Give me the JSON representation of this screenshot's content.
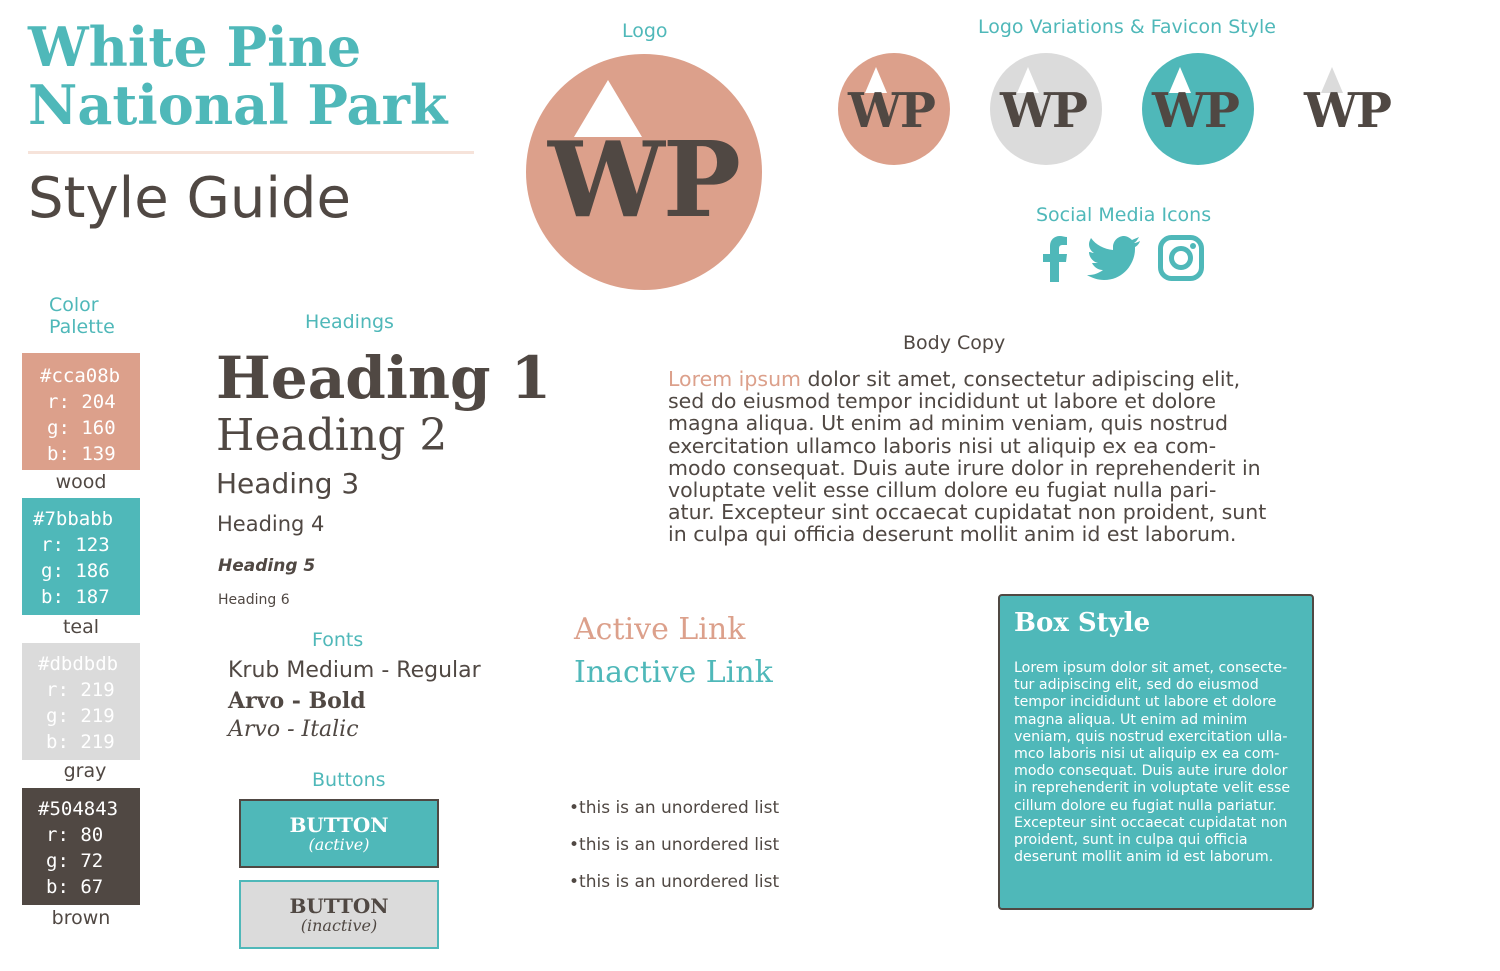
{
  "header": {
    "title_line1": "White Pine",
    "title_line2": "National Park",
    "subtitle": "Style Guide"
  },
  "logo": {
    "label": "Logo",
    "text": "WP"
  },
  "logo_variations": {
    "label": "Logo Variations & Favicon Style",
    "items": [
      {
        "text": "WP",
        "background": "#dca08b",
        "peak": "#ffffff"
      },
      {
        "text": "WP",
        "background": "#dbdbdb",
        "peak": "#ffffff"
      },
      {
        "text": "WP",
        "background": "#4fb8b9",
        "peak": "#ffffff"
      },
      {
        "text": "WP",
        "background": "none",
        "peak": "#dbdbdb"
      }
    ]
  },
  "social": {
    "label": "Social Media Icons",
    "icons": [
      "facebook-icon",
      "twitter-icon",
      "instagram-icon"
    ]
  },
  "palette": {
    "label_line1": "Color",
    "label_line2": "Palette",
    "swatches": [
      {
        "hex": "#cca08b",
        "r": "r: 204",
        "g": "g: 160",
        "b": "b: 139",
        "name": "wood",
        "color": "#dca08b"
      },
      {
        "hex": "#7bbabb",
        "r": "r: 123",
        "g": "g: 186",
        "b": "b: 187",
        "name": "teal",
        "color": "#4fb8b9"
      },
      {
        "hex": "#dbdbdb",
        "r": "r: 219",
        "g": "g: 219",
        "b": "b: 219",
        "name": "gray",
        "color": "#dbdbdb"
      },
      {
        "hex": "#504843",
        "r": "r: 80",
        "g": "g: 72",
        "b": "b: 67",
        "name": "brown",
        "color": "#504843"
      }
    ]
  },
  "headings": {
    "label": "Headings",
    "h1": "Heading 1",
    "h2": "Heading 2",
    "h3": "Heading 3",
    "h4": "Heading 4",
    "h5": "Heading 5",
    "h6": "Heading 6"
  },
  "fonts": {
    "label": "Fonts",
    "regular": "Krub Medium - Regular",
    "bold": "Arvo - Bold",
    "italic": "Arvo - Italic"
  },
  "buttons": {
    "label": "Buttons",
    "active_main": "BUTTON",
    "active_sub": "(active)",
    "inactive_main": "BUTTON",
    "inactive_sub": "(inactive)"
  },
  "body_copy": {
    "label": "Body Copy",
    "lead": "Lorem ipsum",
    "text": " dolor sit amet, consectetur adipiscing elit, sed do eiusmod tempor incididunt ut labore et dolore magna aliqua. Ut enim ad minim veniam, quis nostrud exercitation ullamco laboris nisi ut aliquip ex ea com- modo consequat. Duis aute irure dolor in reprehenderit in voluptate velit esse cillum dolore eu fugiat nulla pari- atur. Excepteur sint occaecat cupidatat non proident, sunt in culpa qui officia deserunt mollit anim id est laborum."
  },
  "links": {
    "active": "Active Link",
    "inactive": "Inactive Link"
  },
  "list": {
    "items": [
      "this is an unordered list",
      "this is an unordered list",
      "this is an unordered list"
    ]
  },
  "box": {
    "title": "Box Style",
    "body": "Lorem ipsum dolor sit amet, consecte- tur adipiscing elit, sed do eiusmod tempor incididunt ut labore et dolore magna aliqua. Ut enim ad minim veniam, quis nostrud exercitation ulla- mco laboris nisi ut aliquip ex ea com- modo consequat. Duis aute irure dolor in reprehenderit in voluptate velit esse cillum dolore eu fugiat nulla pariatur. Excepteur sint occaecat cupidatat non proident, sunt in culpa qui officia deserunt mollit anim id est laborum."
  }
}
